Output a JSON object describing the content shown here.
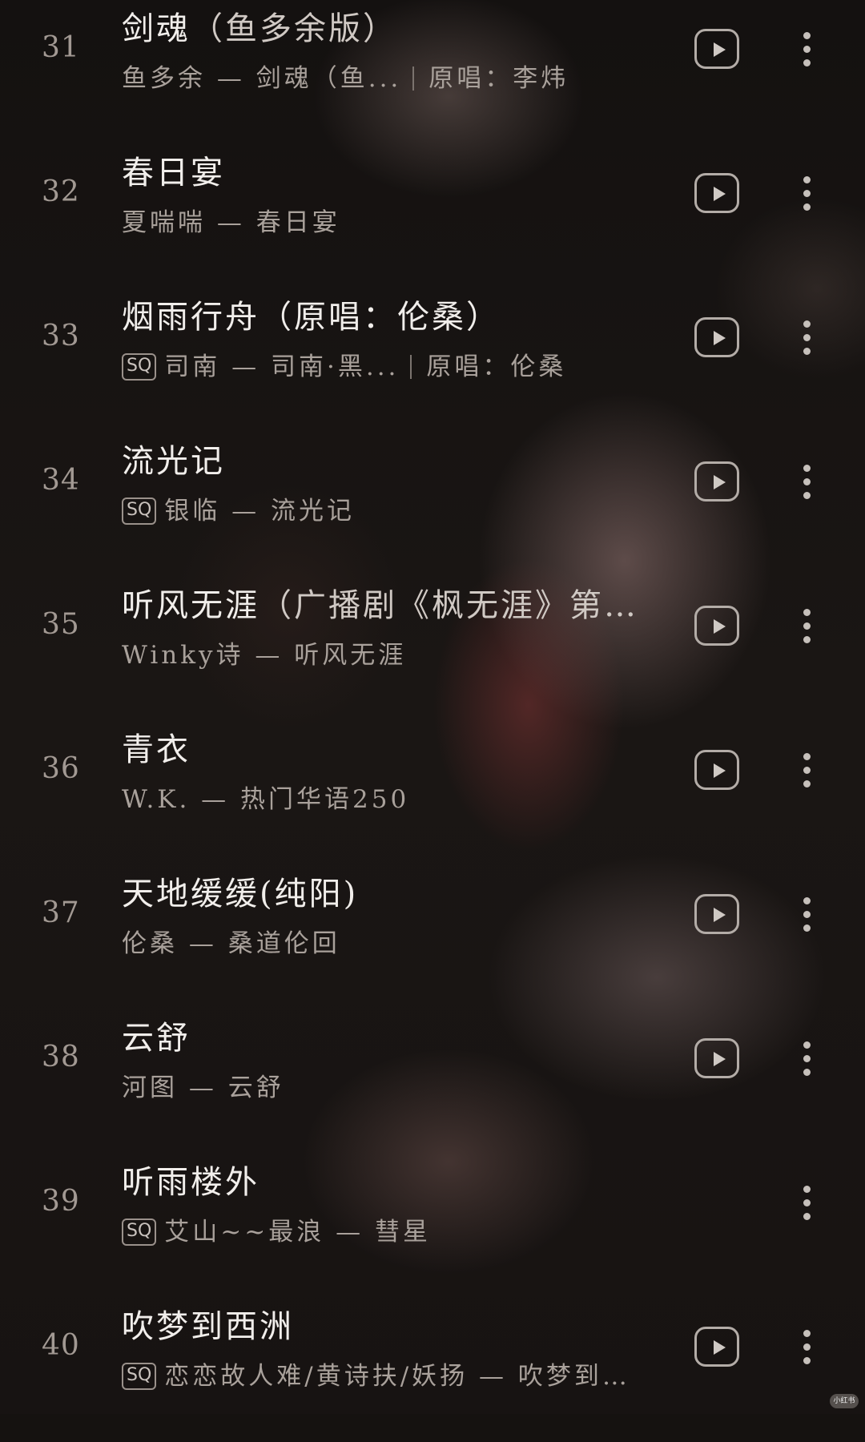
{
  "songs": [
    {
      "num": "31",
      "title": "剑魂",
      "sub": "（鱼多余版）",
      "sq": "",
      "artist": "鱼多余",
      "dash": "—",
      "album": "剑魂（鱼...",
      "note": "原唱：李炜",
      "play_icon": "play-square-icon",
      "more_icon": "more-vertical-icon"
    },
    {
      "num": "32",
      "title": "春日宴",
      "sub": "",
      "sq": "",
      "artist": "夏喘喘",
      "dash": "—",
      "album": "春日宴",
      "note": "",
      "play_icon": "play-square-icon",
      "more_icon": "more-vertical-icon"
    },
    {
      "num": "33",
      "title": "烟雨行舟",
      "sub": "（原唱：伦桑）",
      "sq": "SQ",
      "artist": "司南",
      "dash": "—",
      "album": "司南·黑...",
      "note": "原唱：伦桑",
      "play_icon": "play-square-icon",
      "more_icon": "more-vertical-icon"
    },
    {
      "num": "34",
      "title": "流光记",
      "sub": "",
      "sq": "SQ",
      "artist": "银临",
      "dash": "—",
      "album": "流光记",
      "note": "",
      "play_icon": "play-square-icon",
      "more_icon": "more-vertical-icon"
    },
    {
      "num": "35",
      "title": "听风无涯",
      "sub": "（广播剧《枫无涯》第…",
      "sq": "",
      "artist": "Winky诗",
      "dash": "—",
      "album": "听风无涯",
      "note": "",
      "play_icon": "play-square-icon",
      "more_icon": "more-vertical-icon"
    },
    {
      "num": "36",
      "title": "青衣",
      "sub": "",
      "sq": "",
      "artist": "W.K.",
      "dash": "—",
      "album": "热门华语250",
      "note": "",
      "play_icon": "play-square-icon",
      "more_icon": "more-vertical-icon"
    },
    {
      "num": "37",
      "title": "天地缓缓",
      "sub": "(纯阳)",
      "sq": "",
      "artist": "伦桑",
      "dash": "—",
      "album": "桑道伦回",
      "note": "",
      "play_icon": "play-square-icon",
      "more_icon": "more-vertical-icon"
    },
    {
      "num": "38",
      "title": "云舒",
      "sub": "",
      "sq": "",
      "artist": "河图",
      "dash": "—",
      "album": "云舒",
      "note": "",
      "play_icon": "play-square-icon",
      "more_icon": "more-vertical-icon"
    },
    {
      "num": "39",
      "title": "听雨楼外",
      "sub": "",
      "sq": "SQ",
      "artist": "艾山~~最浪",
      "dash": "—",
      "album": "彗星",
      "note": "",
      "play_icon": "",
      "more_icon": "more-vertical-icon"
    },
    {
      "num": "40",
      "title": "吹梦到西洲",
      "sub": "",
      "sq": "SQ",
      "artist": "恋恋故人难/黄诗扶/妖扬",
      "dash": "—",
      "album": "吹梦到…",
      "note": "",
      "play_icon": "play-square-icon",
      "more_icon": "more-vertical-icon"
    }
  ],
  "watermark": "小红书"
}
